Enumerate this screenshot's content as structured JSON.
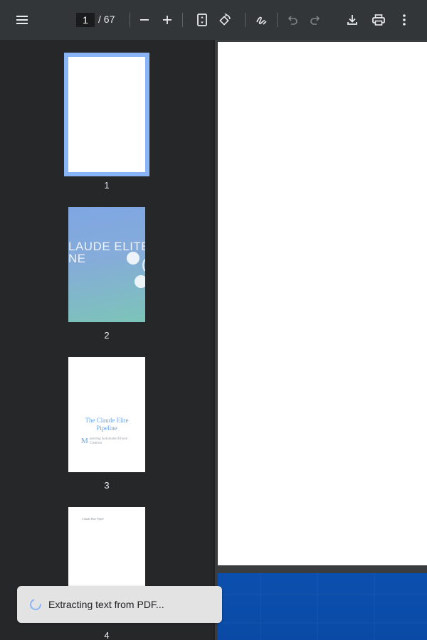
{
  "toolbar": {
    "current_page": "1",
    "total_pages": "/ 67",
    "icons": {
      "menu": "menu-icon",
      "zoom_out": "minus-icon",
      "zoom_in": "plus-icon",
      "fit_page": "fit-to-page-icon",
      "rotate": "rotate-icon",
      "annotate": "pen-icon",
      "undo": "undo-icon",
      "redo": "redo-icon",
      "download": "download-icon",
      "print": "print-icon",
      "more": "more-vertical-icon"
    }
  },
  "sidebar": {
    "thumbnails": [
      {
        "label": "1",
        "selected": true
      },
      {
        "label": "2",
        "selected": false
      },
      {
        "label": "3",
        "selected": false
      },
      {
        "label": "4",
        "selected": false
      }
    ],
    "thumb2": {
      "title_line1": "LAUDE ELITE",
      "title_line2": "NE"
    },
    "thumb3": {
      "title": "The Claude Elite Pipeline",
      "subtitle_initial": "M",
      "subtitle": "astering Automated Ebook Creation"
    },
    "thumb4": {
      "header": "Claude Elite Pipeli"
    }
  },
  "toast": {
    "message": "Extracting text from PDF..."
  },
  "colors": {
    "toolbar": "#323639",
    "sidebar": "#262729",
    "selection": "#8ab4f8",
    "viewer_bg": "#3b3c3e"
  }
}
